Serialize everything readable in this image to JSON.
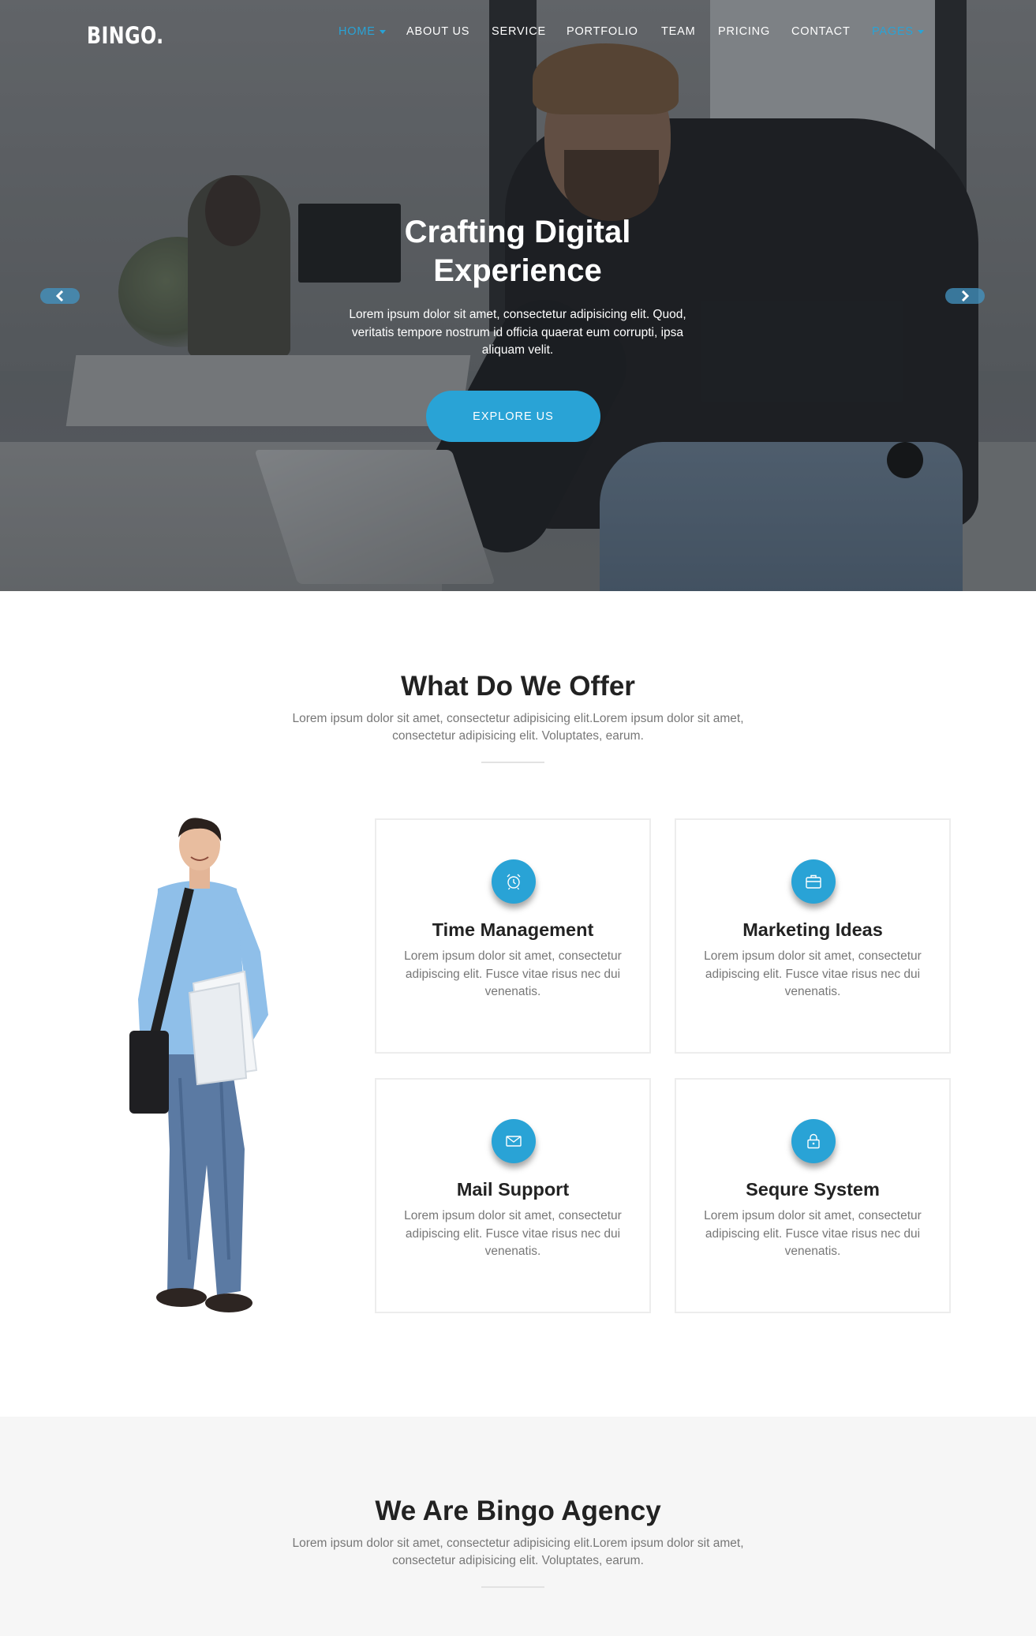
{
  "header": {
    "logo": "BINGO.",
    "nav": [
      {
        "label": "HOME",
        "active": true,
        "dropdown": true
      },
      {
        "label": "ABOUT US",
        "active": false,
        "dropdown": false
      },
      {
        "label": "SERVICE",
        "active": false,
        "dropdown": false
      },
      {
        "label": "PORTFOLIO",
        "active": false,
        "dropdown": false
      },
      {
        "label": "TEAM",
        "active": false,
        "dropdown": false
      },
      {
        "label": "PRICING",
        "active": false,
        "dropdown": false
      },
      {
        "label": "CONTACT",
        "active": false,
        "dropdown": false
      },
      {
        "label": "PAGES",
        "active": true,
        "dropdown": true
      }
    ]
  },
  "hero": {
    "title_line1": "Crafting Digital",
    "title_line2": "Experience",
    "text": "Lorem ipsum dolor sit amet, consectetur adipisicing elit. Quod, veritatis tempore nostrum id officia quaerat eum corrupti, ipsa aliquam velit.",
    "button": "EXPLORE US",
    "prev_icon": "chevron-left-icon",
    "next_icon": "chevron-right-icon"
  },
  "offer": {
    "title": "What Do We Offer",
    "subtitle": "Lorem ipsum dolor sit amet, consectetur adipisicing elit.Lorem ipsum dolor sit amet, consectetur adipisicing elit. Voluptates, earum.",
    "cards": [
      {
        "icon": "alarm-clock-icon",
        "title": "Time Management",
        "text": "Lorem ipsum dolor sit amet, consectetur adipiscing elit. Fusce vitae risus nec dui venenatis."
      },
      {
        "icon": "briefcase-icon",
        "title": "Marketing Ideas",
        "text": "Lorem ipsum dolor sit amet, consectetur adipiscing elit. Fusce vitae risus nec dui venenatis."
      },
      {
        "icon": "envelope-icon",
        "title": "Mail Support",
        "text": "Lorem ipsum dolor sit amet, consectetur adipiscing elit. Fusce vitae risus nec dui venenatis."
      },
      {
        "icon": "lock-icon",
        "title": "Sequre System",
        "text": "Lorem ipsum dolor sit amet, consectetur adipiscing elit. Fusce vitae risus nec dui venenatis."
      }
    ]
  },
  "agency": {
    "title": "We Are Bingo Agency",
    "subtitle": "Lorem ipsum dolor sit amet, consectetur adipisicing elit.Lorem ipsum dolor sit amet, consectetur adipisicing elit. Voluptates, earum."
  },
  "colors": {
    "accent": "#29a3d6",
    "heading": "#222222",
    "body_text": "#777777",
    "section_alt_bg": "#f6f6f6"
  }
}
